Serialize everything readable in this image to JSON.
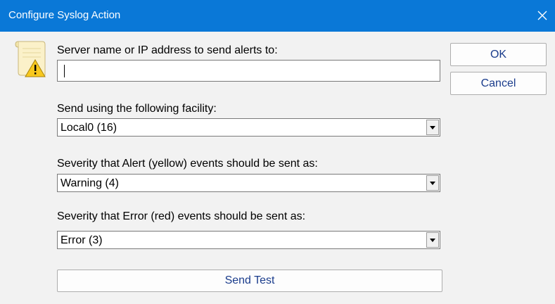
{
  "window": {
    "title": "Configure Syslog Action",
    "close_glyph": "✕"
  },
  "server": {
    "label": "Server name or IP address to send alerts to:",
    "value": ""
  },
  "facility": {
    "label": "Send using the following facility:",
    "selected": "Local0 (16)"
  },
  "alert_severity": {
    "label": "Severity that Alert (yellow) events should be sent as:",
    "selected": "Warning (4)"
  },
  "error_severity": {
    "label": "Severity that Error (red) events should be sent as:",
    "selected": "Error (3)"
  },
  "buttons": {
    "ok": "OK",
    "cancel": "Cancel",
    "send_test": "Send Test"
  },
  "icons": {
    "app": "document-warning-icon",
    "dropdown": "dropdown-arrow-icon",
    "close": "close-icon"
  },
  "colors": {
    "titlebar": "#0a78d7",
    "button_text": "#1a3c8c"
  }
}
